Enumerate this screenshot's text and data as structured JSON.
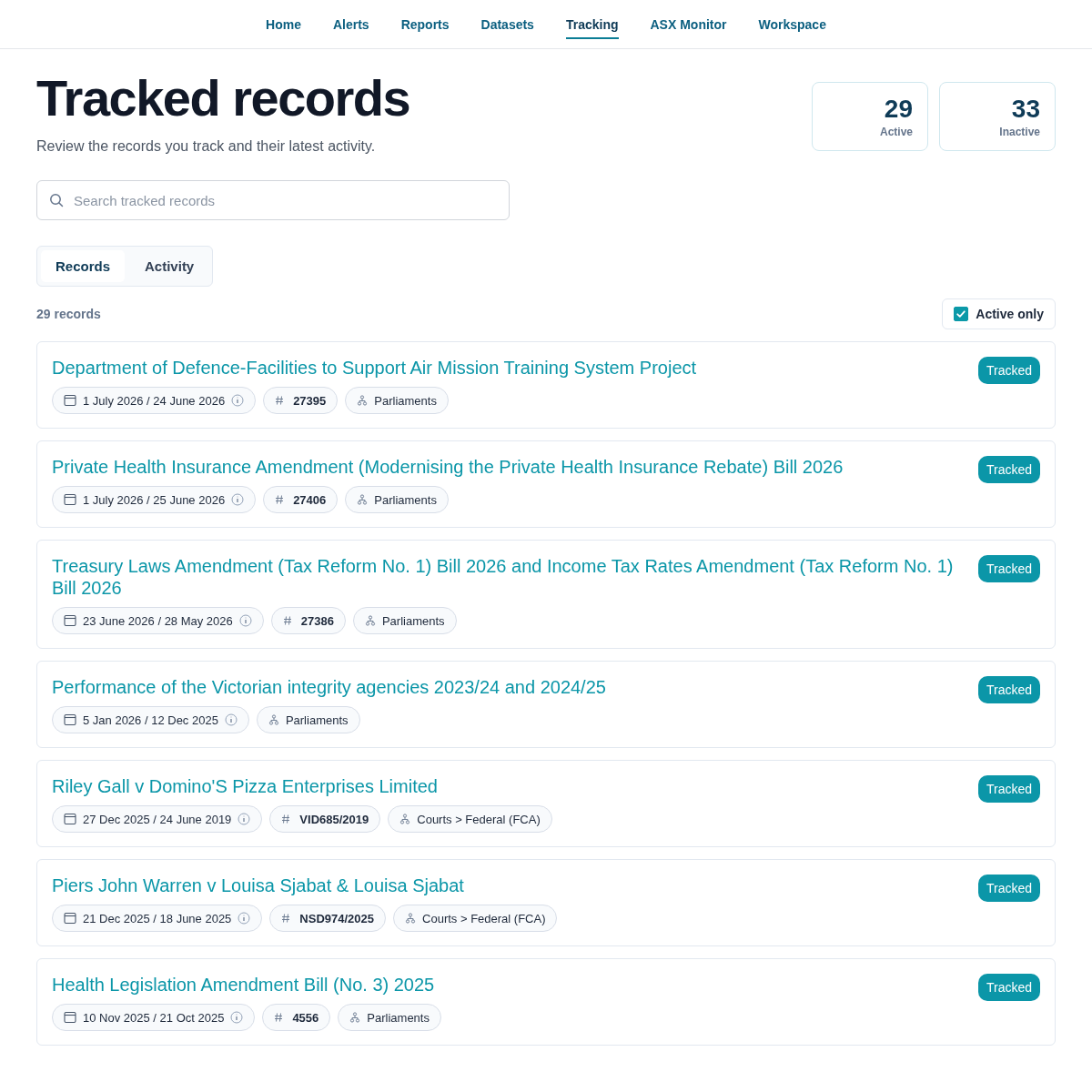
{
  "nav": [
    {
      "label": "Home",
      "selected": false
    },
    {
      "label": "Alerts",
      "selected": false
    },
    {
      "label": "Reports",
      "selected": false
    },
    {
      "label": "Datasets",
      "selected": false
    },
    {
      "label": "Tracking",
      "selected": true
    },
    {
      "label": "ASX Monitor",
      "selected": false
    },
    {
      "label": "Workspace",
      "selected": false
    }
  ],
  "title": "Tracked records",
  "subtitle": "Review the records you track and their latest activity.",
  "stats": [
    {
      "value": "29",
      "label": "Active"
    },
    {
      "value": "33",
      "label": "Inactive"
    }
  ],
  "search": {
    "placeholder": "Search tracked records"
  },
  "tabs": [
    {
      "label": "Records",
      "selected": true
    },
    {
      "label": "Activity",
      "selected": false
    }
  ],
  "count": "29 records",
  "filter": {
    "label": "Active only",
    "checked": true
  },
  "records": [
    {
      "title": "Department of Defence-Facilities to Support Air Mission Training System Project",
      "dates": "1 July 2026 / 24 June 2026",
      "number": "27395",
      "source": "Parliaments",
      "status": "Tracked"
    },
    {
      "title": "Private Health Insurance Amendment (Modernising the Private Health Insurance Rebate) Bill 2026",
      "dates": "1 July 2026 / 25 June 2026",
      "number": "27406",
      "source": "Parliaments",
      "status": "Tracked"
    },
    {
      "title": "Treasury Laws Amendment (Tax Reform No. 1) Bill 2026 and Income Tax Rates Amendment (Tax Reform No. 1) Bill 2026",
      "dates": "23 June 2026 / 28 May 2026",
      "number": "27386",
      "source": "Parliaments",
      "status": "Tracked"
    },
    {
      "title": "Performance of the Victorian integrity agencies 2023/24 and 2024/25",
      "dates": "5 Jan 2026 / 12 Dec 2025",
      "source": "Parliaments",
      "status": "Tracked"
    },
    {
      "title": "Riley Gall v Domino'S Pizza Enterprises Limited",
      "dates": "27 Dec 2025 / 24 June 2019",
      "number": "VID685/2019",
      "source": "Courts > Federal (FCA)",
      "status": "Tracked"
    },
    {
      "title": "Piers John Warren v Louisa Sjabat & Louisa Sjabat",
      "dates": "21 Dec 2025 / 18 June 2025",
      "number": "NSD974/2025",
      "source": "Courts > Federal (FCA)",
      "status": "Tracked"
    },
    {
      "title": "Health Legislation Amendment Bill (No. 3) 2025",
      "dates": "10 Nov 2025 / 21 Oct 2025",
      "number": "4556",
      "source": "Parliaments",
      "status": "Tracked"
    }
  ]
}
